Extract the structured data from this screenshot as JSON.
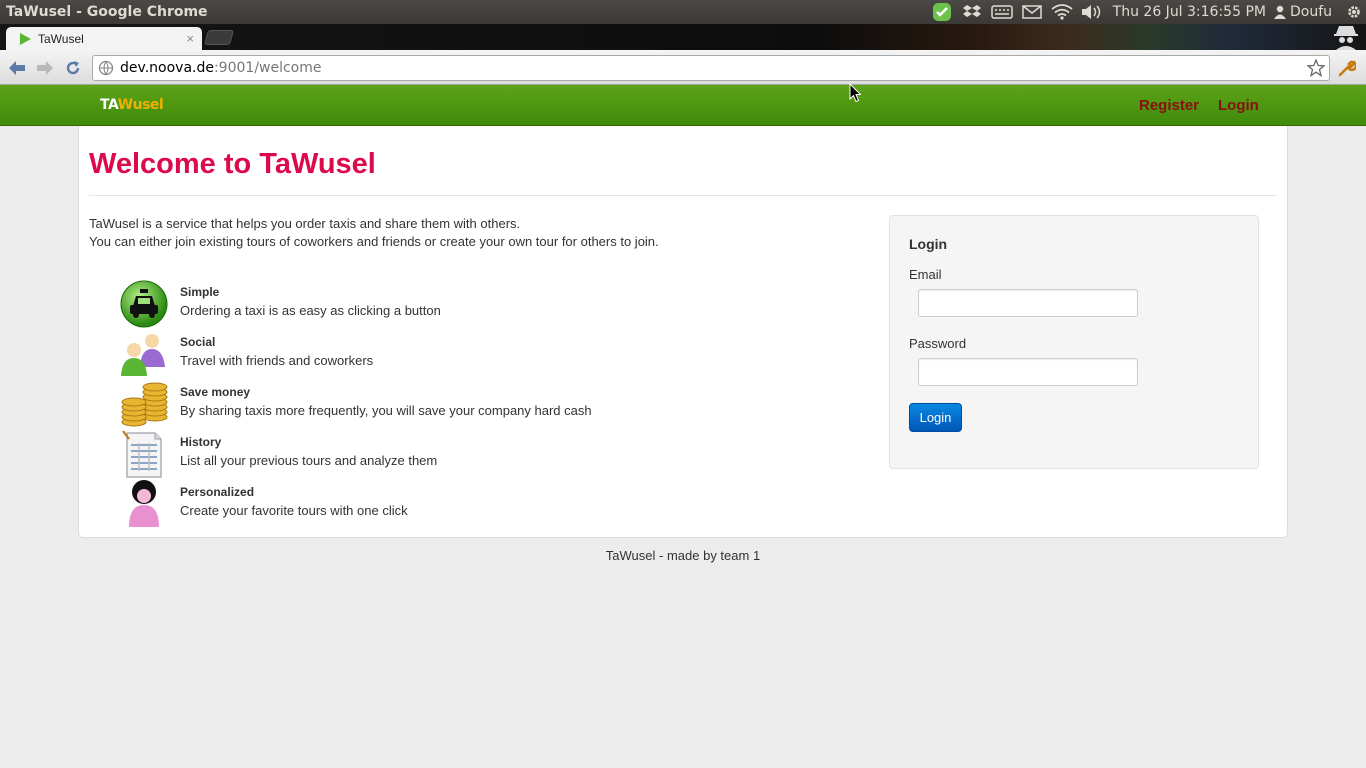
{
  "os_panel": {
    "window_title": "TaWusel - Google Chrome",
    "clock": "Thu 26 Jul  3:16:55 PM",
    "user": "Doufu"
  },
  "browser": {
    "tab_title": "TaWusel",
    "tab_close": "×",
    "url_host": "dev.noova.de",
    "url_rest": ":9001/welcome"
  },
  "navbar": {
    "brand_ta": "TA",
    "brand_wusel": "Wusel",
    "register_label": "Register",
    "login_label": "Login"
  },
  "main": {
    "title": "Welcome to TaWusel",
    "intro_line1": "TaWusel is a service that helps you order taxis and share them with others.",
    "intro_line2": "You can either join existing tours of coworkers and friends or create your own tour for others to join.",
    "features": [
      {
        "title": "Simple",
        "desc": "Ordering a taxi is as easy as clicking a button",
        "icon": "taxi-icon"
      },
      {
        "title": "Social",
        "desc": "Travel with friends and coworkers",
        "icon": "people-icon"
      },
      {
        "title": "Save money",
        "desc": "By sharing taxis more frequently, you will save your company hard cash",
        "icon": "coins-icon"
      },
      {
        "title": "History",
        "desc": "List all your previous tours and analyze them",
        "icon": "document-icon"
      },
      {
        "title": "Personalized",
        "desc": "Create your favorite tours with one click",
        "icon": "person-icon"
      }
    ]
  },
  "login_form": {
    "heading": "Login",
    "email_label": "Email",
    "email_value": "",
    "password_label": "Password",
    "password_value": "",
    "submit_label": "Login"
  },
  "footer": {
    "text": "TaWusel - made by team 1"
  },
  "colors": {
    "navbar_green": "#4f9a12",
    "title_pink": "#dc0a4c",
    "nav_link": "#8a0f0f",
    "button_blue": "#0a6fd0"
  }
}
